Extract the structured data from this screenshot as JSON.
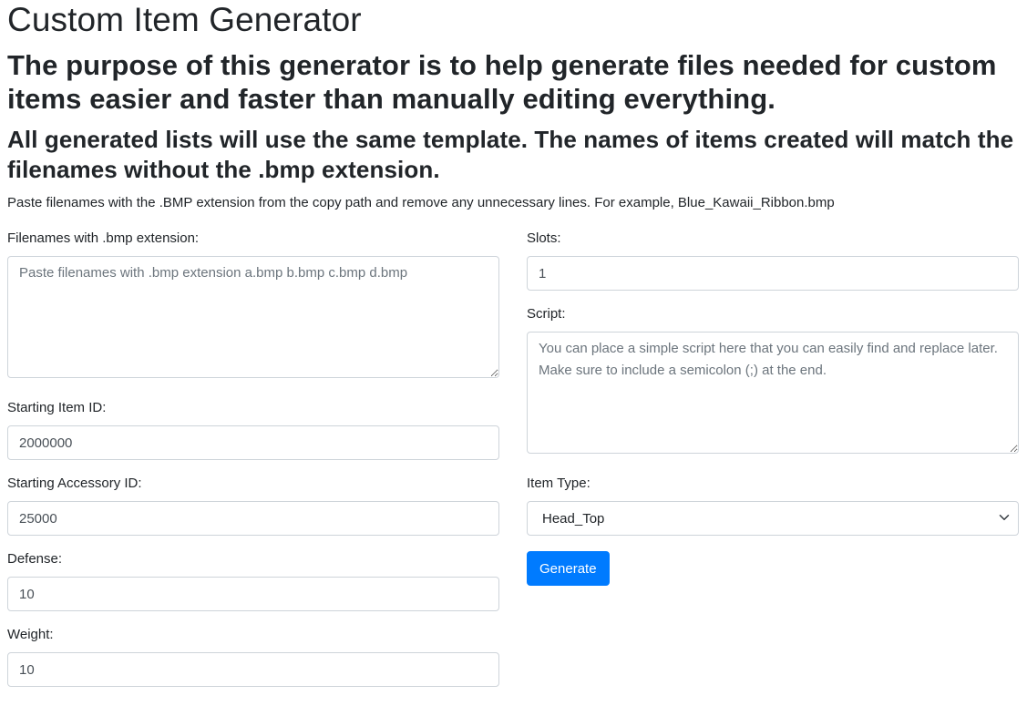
{
  "header": {
    "title": "Custom Item Generator",
    "purpose": "The purpose of this generator is to help generate files needed for custom items easier and faster than manually editing everything.",
    "template_note": "All generated lists will use the same template. The names of items created will match the filenames without the .bmp extension.",
    "instructions": "Paste filenames with the .BMP extension from the copy path and remove any unnecessary lines. For example, Blue_Kawaii_Ribbon.bmp"
  },
  "form": {
    "filenames": {
      "label": "Filenames with .bmp extension:",
      "placeholder": "Paste filenames with .bmp extension a.bmp b.bmp c.bmp d.bmp",
      "value": ""
    },
    "starting_item_id": {
      "label": "Starting Item ID:",
      "value": "2000000"
    },
    "starting_accessory_id": {
      "label": "Starting Accessory ID:",
      "value": "25000"
    },
    "defense": {
      "label": "Defense:",
      "value": "10"
    },
    "weight": {
      "label": "Weight:",
      "value": "10"
    },
    "slots": {
      "label": "Slots:",
      "value": "1"
    },
    "script": {
      "label": "Script:",
      "placeholder": "You can place a simple script here that you can easily find and replace later. Make sure to include a semicolon (;) at the end.",
      "value": ""
    },
    "item_type": {
      "label": "Item Type:",
      "selected": "Head_Top"
    },
    "generate_label": "Generate"
  },
  "colors": {
    "primary": "#007bff",
    "border": "#ced4da",
    "text": "#212529"
  }
}
